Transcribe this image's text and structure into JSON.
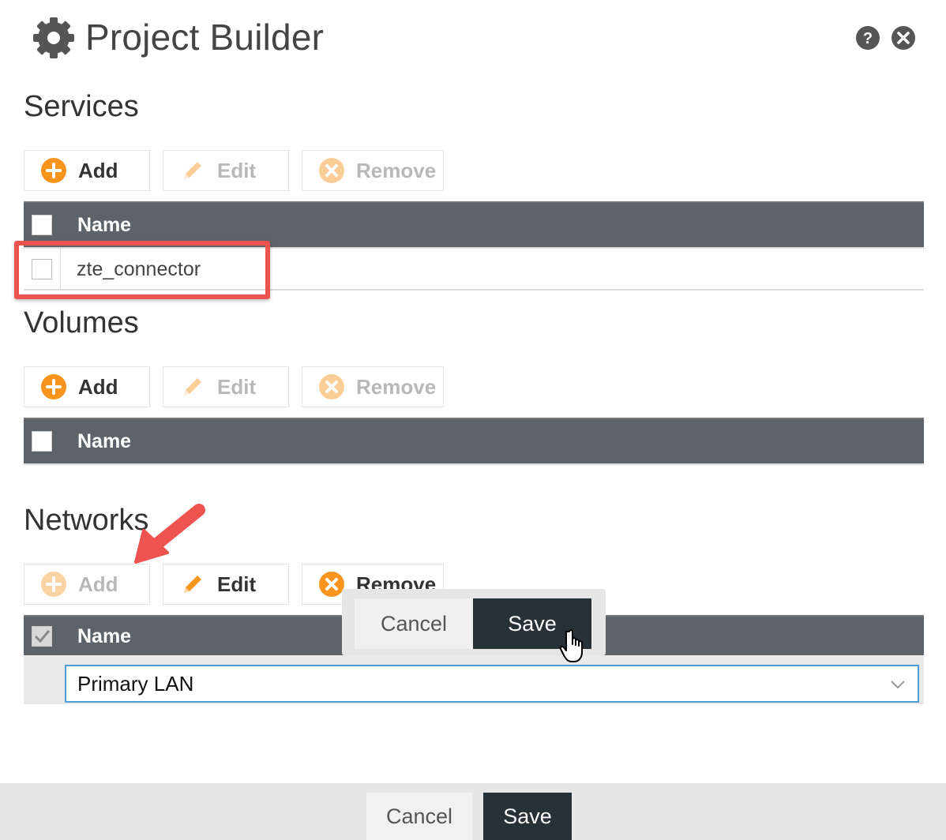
{
  "header": {
    "title": "Project Builder",
    "icon": "gear-icon",
    "help_icon": "help-icon",
    "close_icon": "close-icon"
  },
  "services": {
    "title": "Services",
    "toolbar": {
      "add": "Add",
      "edit": "Edit",
      "remove": "Remove",
      "add_enabled": true,
      "edit_enabled": false,
      "remove_enabled": false
    },
    "columns": [
      "Name"
    ],
    "rows": [
      {
        "name": "zte_connector",
        "checked": false
      }
    ]
  },
  "volumes": {
    "title": "Volumes",
    "toolbar": {
      "add": "Add",
      "edit": "Edit",
      "remove": "Remove",
      "add_enabled": true,
      "edit_enabled": false,
      "remove_enabled": false
    },
    "columns": [
      "Name"
    ],
    "rows": []
  },
  "networks": {
    "title": "Networks",
    "toolbar": {
      "add": "Add",
      "edit": "Edit",
      "remove": "Remove",
      "add_enabled": false,
      "edit_enabled": true,
      "remove_enabled": true
    },
    "columns": [
      "Name"
    ],
    "header_checked": true,
    "edit_row": {
      "selected_value": "Primary LAN"
    },
    "row_popup": {
      "cancel": "Cancel",
      "save": "Save"
    }
  },
  "footer": {
    "cancel": "Cancel",
    "save": "Save"
  },
  "colors": {
    "accent_orange": "#f7941d",
    "grid_header": "#5d636b",
    "primary_button": "#263238",
    "highlight": "#ef5350",
    "focus_border": "#4a9fd8"
  }
}
